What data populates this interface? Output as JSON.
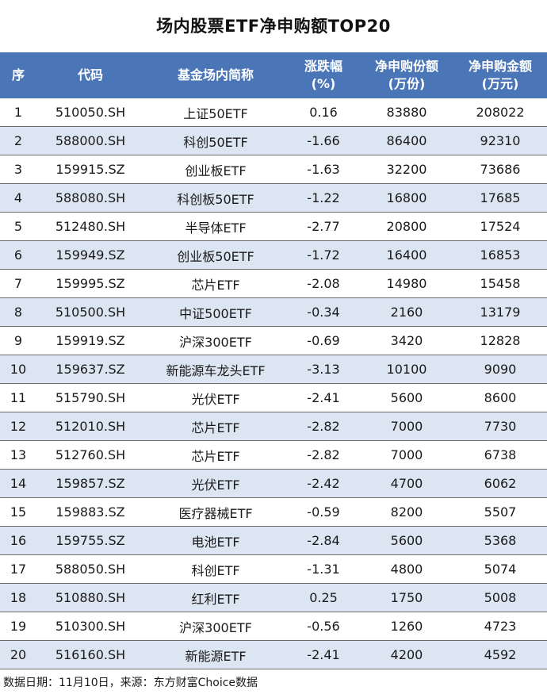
{
  "title": "场内股票ETF净申购额TOP20",
  "headers": {
    "seq": "序",
    "code": "代码",
    "name": "基金场内简称",
    "change_l1": "涨跌幅",
    "change_l2": "(%)",
    "shares_l1": "净申购份额",
    "shares_l2": "(万份)",
    "amount_l1": "净申购金额",
    "amount_l2": "(万元)"
  },
  "rows": [
    {
      "seq": "1",
      "code": "510050.SH",
      "name": "上证50ETF",
      "change": "0.16",
      "shares": "83880",
      "amount": "208022"
    },
    {
      "seq": "2",
      "code": "588000.SH",
      "name": "科创50ETF",
      "change": "-1.66",
      "shares": "86400",
      "amount": "92310"
    },
    {
      "seq": "3",
      "code": "159915.SZ",
      "name": "创业板ETF",
      "change": "-1.63",
      "shares": "32200",
      "amount": "73686"
    },
    {
      "seq": "4",
      "code": "588080.SH",
      "name": "科创板50ETF",
      "change": "-1.22",
      "shares": "16800",
      "amount": "17685"
    },
    {
      "seq": "5",
      "code": "512480.SH",
      "name": "半导体ETF",
      "change": "-2.77",
      "shares": "20800",
      "amount": "17524"
    },
    {
      "seq": "6",
      "code": "159949.SZ",
      "name": "创业板50ETF",
      "change": "-1.72",
      "shares": "16400",
      "amount": "16853"
    },
    {
      "seq": "7",
      "code": "159995.SZ",
      "name": "芯片ETF",
      "change": "-2.08",
      "shares": "14980",
      "amount": "15458"
    },
    {
      "seq": "8",
      "code": "510500.SH",
      "name": "中证500ETF",
      "change": "-0.34",
      "shares": "2160",
      "amount": "13179"
    },
    {
      "seq": "9",
      "code": "159919.SZ",
      "name": "沪深300ETF",
      "change": "-0.69",
      "shares": "3420",
      "amount": "12828"
    },
    {
      "seq": "10",
      "code": "159637.SZ",
      "name": "新能源车龙头ETF",
      "change": "-3.13",
      "shares": "10100",
      "amount": "9090"
    },
    {
      "seq": "11",
      "code": "515790.SH",
      "name": "光伏ETF",
      "change": "-2.41",
      "shares": "5600",
      "amount": "8600"
    },
    {
      "seq": "12",
      "code": "512010.SH",
      "name": "芯片ETF",
      "change": "-2.82",
      "shares": "7000",
      "amount": "7730"
    },
    {
      "seq": "13",
      "code": "512760.SH",
      "name": "芯片ETF",
      "change": "-2.82",
      "shares": "7000",
      "amount": "6738"
    },
    {
      "seq": "14",
      "code": "159857.SZ",
      "name": "光伏ETF",
      "change": "-2.42",
      "shares": "4700",
      "amount": "6062"
    },
    {
      "seq": "15",
      "code": "159883.SZ",
      "name": "医疗器械ETF",
      "change": "-0.59",
      "shares": "8200",
      "amount": "5507"
    },
    {
      "seq": "16",
      "code": "159755.SZ",
      "name": "电池ETF",
      "change": "-2.84",
      "shares": "5600",
      "amount": "5368"
    },
    {
      "seq": "17",
      "code": "588050.SH",
      "name": "科创ETF",
      "change": "-1.31",
      "shares": "4800",
      "amount": "5074"
    },
    {
      "seq": "18",
      "code": "510880.SH",
      "name": "红利ETF",
      "change": "0.25",
      "shares": "1750",
      "amount": "5008"
    },
    {
      "seq": "19",
      "code": "510300.SH",
      "name": "沪深300ETF",
      "change": "-0.56",
      "shares": "1260",
      "amount": "4723"
    },
    {
      "seq": "20",
      "code": "516160.SH",
      "name": "新能源ETF",
      "change": "-2.41",
      "shares": "4200",
      "amount": "4592"
    }
  ],
  "footer": "数据日期：11月10日，来源：东方财富Choice数据",
  "colors": {
    "header_bg": "#4a76b8",
    "stripe_bg": "#dce5f2"
  }
}
